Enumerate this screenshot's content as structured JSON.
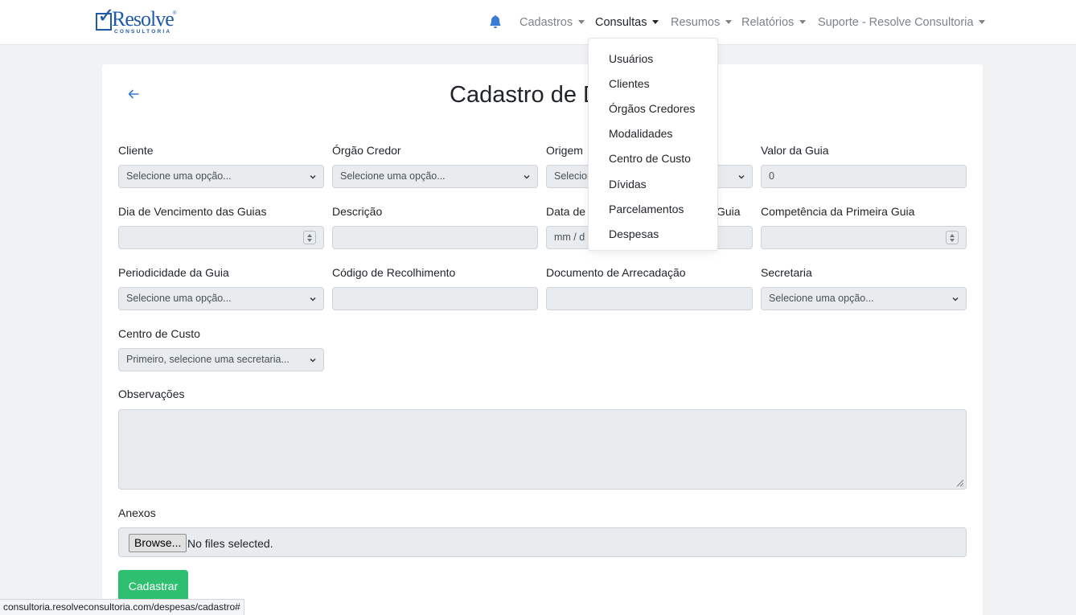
{
  "logo": {
    "word": "Resolve",
    "sub": "CONSULTORIA"
  },
  "nav": {
    "items": [
      {
        "label": "Cadastros"
      },
      {
        "label": "Consultas"
      },
      {
        "label": "Resumos"
      },
      {
        "label": "Relatórios"
      },
      {
        "label": "Suporte - Resolve Consultoria"
      }
    ],
    "active": "Consultas"
  },
  "dropdown": {
    "items": [
      "Usuários",
      "Clientes",
      "Órgãos Credores",
      "Modalidades",
      "Centro de Custo",
      "Dívidas",
      "Parcelamentos",
      "Despesas"
    ]
  },
  "page": {
    "title": "Cadastro de D"
  },
  "form": {
    "cliente": {
      "label": "Cliente",
      "value": "Selecione uma opção..."
    },
    "orgao": {
      "label": "Órgão Credor",
      "value": "Selecione uma opção..."
    },
    "origem": {
      "label": "Origem",
      "value": "Selecion"
    },
    "valor": {
      "label": "Valor da Guia",
      "value": "0"
    },
    "dia_venc": {
      "label": "Dia de Vencimento das Guias",
      "value": ""
    },
    "descricao": {
      "label": "Descrição",
      "value": ""
    },
    "data": {
      "label_left": "Data de",
      "label_right": "Guia",
      "value": "mm / d"
    },
    "competencia": {
      "label": "Competência da Primeira Guia",
      "value": ""
    },
    "periodicidade": {
      "label": "Periodicidade da Guia",
      "value": "Selecione uma opção..."
    },
    "codigo": {
      "label": "Código de Recolhimento",
      "value": ""
    },
    "documento": {
      "label": "Documento de Arrecadação",
      "value": ""
    },
    "secretaria": {
      "label": "Secretaria",
      "value": "Selecione uma opção..."
    },
    "centro": {
      "label": "Centro de Custo",
      "value": "Primeiro, selecione uma secretaria..."
    },
    "observacoes": {
      "label": "Observações"
    },
    "anexos": {
      "label": "Anexos",
      "browse": "Browse...",
      "status": "No files selected."
    },
    "submit": "Cadastrar"
  },
  "statusbar": {
    "url": "consultoria.resolveconsultoria.com/despesas/cadastro#"
  },
  "colors": {
    "brand": "#1e5aa8",
    "accent": "#3a7bd5",
    "submit": "#2fbf71"
  },
  "icons": {
    "bell": "bell-icon",
    "back": "arrow-left-icon"
  }
}
